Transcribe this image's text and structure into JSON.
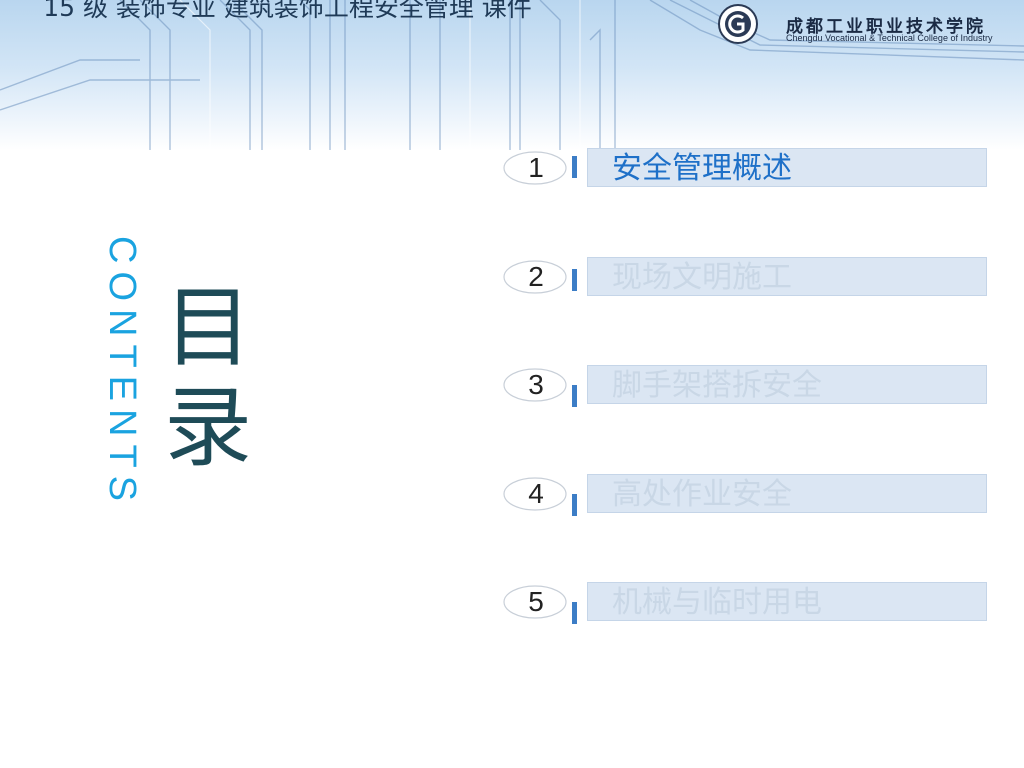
{
  "header": {
    "title": "15 级 装饰专业 建筑装饰工程安全管理 课件",
    "logo_cn": "成都工业职业技术学院",
    "logo_en": "Chengdu Vocational & Technical College of Industry"
  },
  "toc": {
    "heading": "目录",
    "heading_char_1": "目",
    "heading_char_2": "录",
    "contents_word": "CONTENTS",
    "items": [
      {
        "num": "1",
        "label": "安全管理概述",
        "state": "active"
      },
      {
        "num": "2",
        "label": "现场文明施工",
        "state": "inactive"
      },
      {
        "num": "3",
        "label": "脚手架搭拆安全",
        "state": "inactive"
      },
      {
        "num": "4",
        "label": "高处作业安全",
        "state": "inactive"
      },
      {
        "num": "5",
        "label": "机械与临时用电",
        "state": "inactive"
      }
    ]
  },
  "colors": {
    "active_text": "#1e70c8",
    "inactive_text": "#c9d7e6",
    "heading": "#1e4b57",
    "contents_word": "#1aa3e0",
    "accent_bar": "#3c7dc6",
    "item_box": "#dbe6f3"
  }
}
